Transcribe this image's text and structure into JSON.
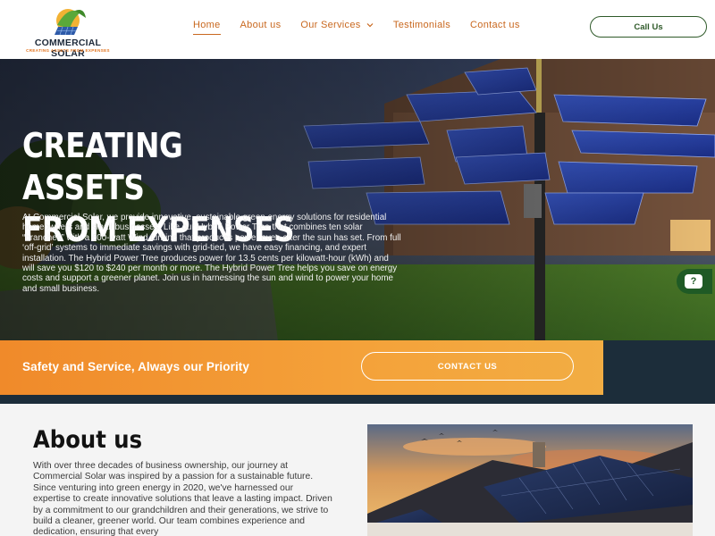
{
  "header": {
    "logo_name": "COMMERCIAL SOLAR",
    "logo_tagline": "CREATING ASSETS FROM EXPENSES",
    "nav": [
      {
        "label": "Home"
      },
      {
        "label": "About us"
      },
      {
        "label": "Our Services"
      },
      {
        "label": "Testimonials"
      },
      {
        "label": "Contact us"
      }
    ],
    "call_label": "Call Us"
  },
  "hero": {
    "title_line1": "CREATING ASSETS",
    "title_line2": "FROM EXPENSES",
    "body": "At Commercial Solar, we provide innovative, sustainable green energy solutions for residential homeowners and small businesses. Like our Hybrid Power Tree that combines ten solar “branches” with a 600-watt Wind turbine that produces power even after the sun has set. From full ‘off-grid’ systems to immediate savings with grid-tied, we have easy financing, and expert installation. The Hybrid Power Tree produces power for 13.5 cents per kilowatt-hour (kWh) and will save you $120 to $240 per month or more. The Hybrid Power Tree helps you save on energy costs and support a greener planet. Join us in harnessing the sun and wind to power your home and small business."
  },
  "promo": {
    "text": "Safety and Service, Always our Priority",
    "button_label": "CONTACT US"
  },
  "about": {
    "title": "About us",
    "body": "With over three decades of business ownership, our journey at Commercial Solar was inspired by a passion for a sustainable future. Since venturing into green energy in 2020, we've harnessed our expertise to create innovative solutions that leave a lasting impact. Driven by a commitment to our grandchildren and their generations, we strive to build a cleaner, greener world. Our team combines experience and dedication, ensuring that every"
  },
  "colors": {
    "accent_orange": "#c9681f",
    "brand_green": "#2f5a2a",
    "promo_start": "#f08a2a",
    "promo_end": "#f2ad43",
    "dark_navy": "#1c2d3a"
  }
}
